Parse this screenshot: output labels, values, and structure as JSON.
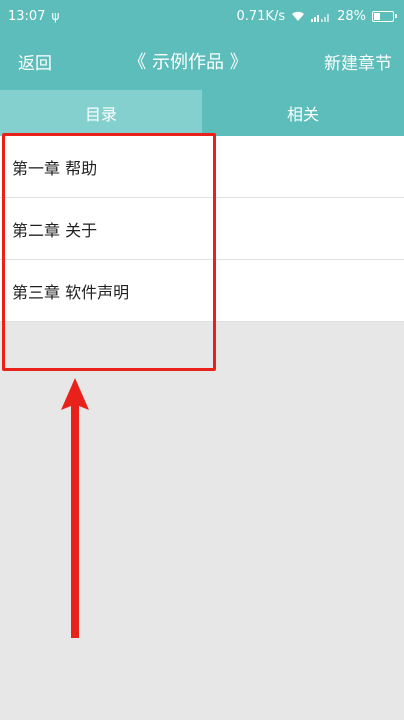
{
  "status_bar": {
    "time": "13:07",
    "usb_icon": "usb-icon",
    "network_speed": "0.71K/s",
    "wifi_icon": "wifi-icon",
    "signal_icon": "signal-icon",
    "battery_percent": "28%",
    "battery_level": 0.28
  },
  "header": {
    "back_label": "返回",
    "title": "《 示例作品 》",
    "new_chapter_label": "新建章节"
  },
  "tabs": [
    {
      "label": "目录",
      "active": true
    },
    {
      "label": "相关",
      "active": false
    }
  ],
  "chapters": [
    {
      "label": "第一章 帮助"
    },
    {
      "label": "第二章 关于"
    },
    {
      "label": "第三章 软件声明"
    }
  ],
  "annotation": {
    "highlight_color": "#e8221b",
    "arrow_color": "#e8221b"
  },
  "colors": {
    "accent": "#5cbdbb",
    "active_tab": "#84d0cf",
    "background": "#e7e7e7"
  }
}
